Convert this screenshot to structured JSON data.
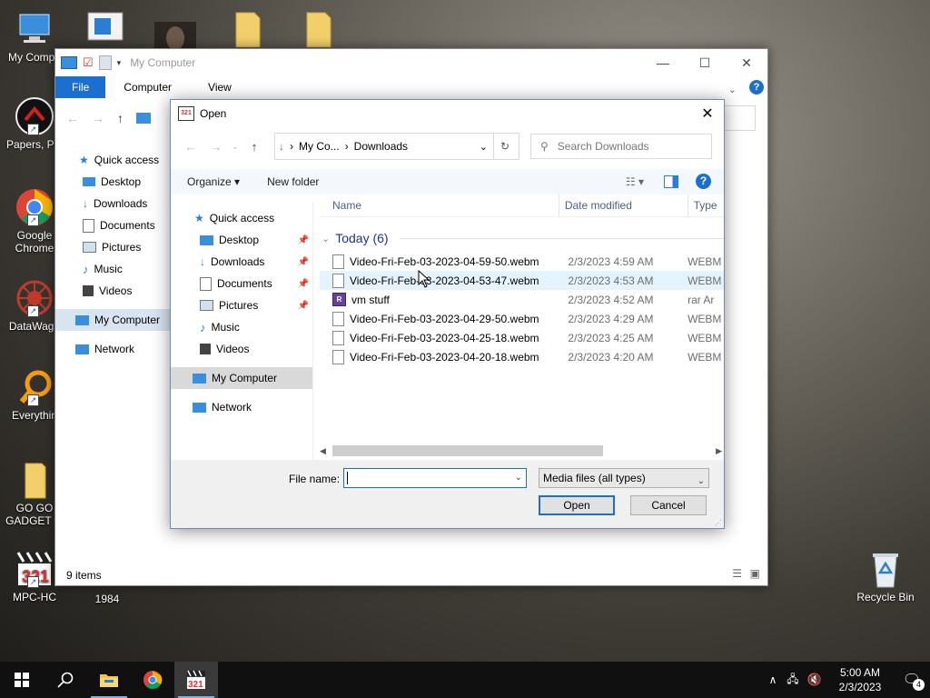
{
  "desktop_icons": [
    {
      "label": "My Compu",
      "icon": "computer-icon"
    },
    {
      "label": "Papers, Ple",
      "icon": "papers-please-icon"
    },
    {
      "label": "Google Chrome",
      "icon": "chrome-icon"
    },
    {
      "label": "DataWago",
      "icon": "datawagon-icon"
    },
    {
      "label": "Everythin",
      "icon": "everything-search-icon"
    },
    {
      "label": "GO GO GADGET ...",
      "icon": "folder-icon"
    },
    {
      "label": "MPC-HC",
      "icon": "mpc-hc-icon"
    },
    {
      "label": "1984",
      "icon": "book-icon"
    },
    {
      "label": "Recycle Bin",
      "icon": "recycle-bin-icon"
    }
  ],
  "explorer": {
    "title": "My Computer",
    "tabs": [
      "File",
      "Computer",
      "View"
    ],
    "sidebar": [
      "Quick access",
      "Desktop",
      "Downloads",
      "Documents",
      "Pictures",
      "Music",
      "Videos",
      "My Computer",
      "Network"
    ],
    "status": "9 items",
    "window_controls": [
      "—",
      "☐",
      "✕"
    ]
  },
  "dialog": {
    "title": "Open",
    "breadcrumb": [
      "My Co...",
      "Downloads"
    ],
    "search_placeholder": "Search Downloads",
    "toolbar": {
      "organize": "Organize ▾",
      "new_folder": "New folder"
    },
    "nav_pane": {
      "quick_access": "Quick access",
      "pinned": [
        "Desktop",
        "Downloads",
        "Documents",
        "Pictures"
      ],
      "unpinned": [
        "Music",
        "Videos"
      ],
      "my_computer": "My Computer",
      "network": "Network"
    },
    "columns": [
      "Name",
      "Date modified",
      "Type"
    ],
    "group": "Today (6)",
    "files": [
      {
        "name": "Video-Fri-Feb-03-2023-04-59-50.webm",
        "date": "2/3/2023 4:59 AM",
        "type": "WEBM"
      },
      {
        "name": "Video-Fri-Feb-03-2023-04-53-47.webm",
        "date": "2/3/2023 4:53 AM",
        "type": "WEBM"
      },
      {
        "name": "vm stuff",
        "date": "2/3/2023 4:52 AM",
        "type": "rar Ar"
      },
      {
        "name": "Video-Fri-Feb-03-2023-04-29-50.webm",
        "date": "2/3/2023 4:29 AM",
        "type": "WEBM"
      },
      {
        "name": "Video-Fri-Feb-03-2023-04-25-18.webm",
        "date": "2/3/2023 4:25 AM",
        "type": "WEBM"
      },
      {
        "name": "Video-Fri-Feb-03-2023-04-20-18.webm",
        "date": "2/3/2023 4:20 AM",
        "type": "WEBM"
      }
    ],
    "file_name_label": "File name:",
    "file_name_value": "",
    "file_type": "Media files (all types)",
    "open_button": "Open",
    "cancel_button": "Cancel"
  },
  "taskbar": {
    "time": "5:00 AM",
    "date": "2/3/2023",
    "notification_count": "4"
  }
}
